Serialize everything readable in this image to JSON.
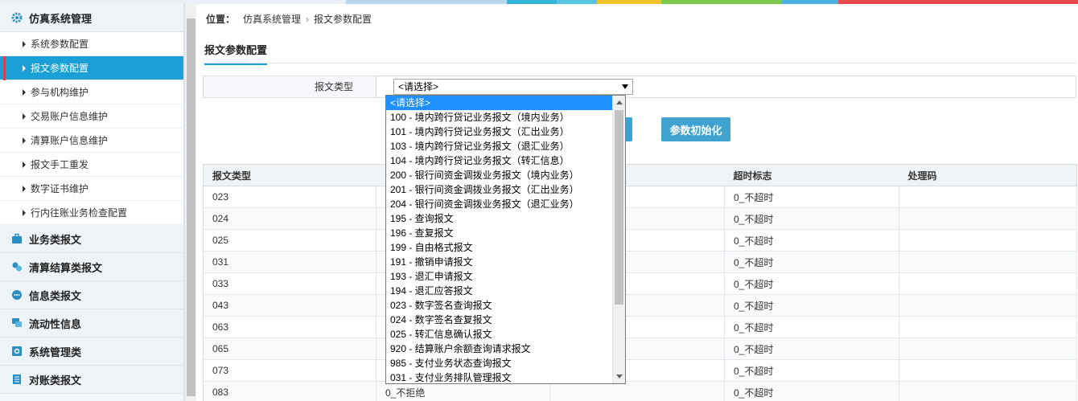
{
  "top_strip_colors": [
    "#eaf0f5",
    "#b9d6ea",
    "#35b3d8",
    "#57c3e6",
    "#f3c327",
    "#7ac94a",
    "#4cb3e0",
    "#e8494b"
  ],
  "sidebar": {
    "groups": [
      {
        "label": "仿真系统管理",
        "icon": "gear-icon",
        "expanded": true,
        "items": [
          "系统参数配置",
          "报文参数配置",
          "参与机构维护",
          "交易账户信息维护",
          "清算账户信息维护",
          "报文手工重发",
          "数字证书维护",
          "行内往账业务检查配置"
        ],
        "active_index": 1
      },
      {
        "label": "业务类报文",
        "icon": "briefcase-icon"
      },
      {
        "label": "清算结算类报文",
        "icon": "coins-icon"
      },
      {
        "label": "信息类报文",
        "icon": "chat-icon"
      },
      {
        "label": "流动性信息",
        "icon": "messages-icon"
      },
      {
        "label": "系统管理类",
        "icon": "settings-icon"
      },
      {
        "label": "对账类报文",
        "icon": "ledger-icon"
      }
    ]
  },
  "breadcrumb": {
    "prefix": "位置：",
    "items": [
      "仿真系统管理",
      "报文参数配置"
    ],
    "separator": "›"
  },
  "page_title": "报文参数配置",
  "form": {
    "label": "报文类型",
    "select_value": "<请选择>"
  },
  "buttons": {
    "hidden_button": "",
    "init_button": "参数初始化"
  },
  "dropdown": {
    "selected_index": 0,
    "options": [
      "<请选择>",
      "100 - 境内跨行贷记业务报文（境内业务）",
      "101 - 境内跨行贷记业务报文（汇出业务）",
      "103 - 境内跨行贷记业务报文（退汇业务）",
      "104 - 境内跨行贷记业务报文（转汇信息）",
      "200 - 银行间资金调拨业务报文（境内业务）",
      "201 - 银行间资金调拨业务报文（汇出业务）",
      "204 - 银行间资金调拨业务报文（退汇业务）",
      "195 - 查询报文",
      "196 - 查复报文",
      "199 - 自由格式报文",
      "191 - 撤销申请报文",
      "193 - 退汇申请报文",
      "194 - 退汇应答报文",
      "023 - 数字签名查询报文",
      "024 - 数字签名查复报文",
      "025 - 转汇信息确认报文",
      "920 - 结算账户余额查询请求报文",
      "985 - 支付业务状态查询报文",
      "031 - 支付业务排队管理报文"
    ]
  },
  "table": {
    "headers": [
      "报文类型",
      "",
      "",
      "超时标志",
      "处理码"
    ],
    "rows": [
      [
        "023",
        "",
        "",
        "0_不超时",
        ""
      ],
      [
        "024",
        "",
        "",
        "0_不超时",
        ""
      ],
      [
        "025",
        "",
        "",
        "0_不超时",
        ""
      ],
      [
        "031",
        "",
        "",
        "0_不超时",
        ""
      ],
      [
        "033",
        "",
        "",
        "0_不超时",
        ""
      ],
      [
        "043",
        "",
        "",
        "0_不超时",
        ""
      ],
      [
        "063",
        "",
        "",
        "0_不超时",
        ""
      ],
      [
        "065",
        "",
        "",
        "0_不超时",
        ""
      ],
      [
        "073",
        "",
        "",
        "0_不超时",
        ""
      ],
      [
        "083",
        "0_不拒绝",
        "",
        "0_不超时",
        ""
      ]
    ]
  }
}
